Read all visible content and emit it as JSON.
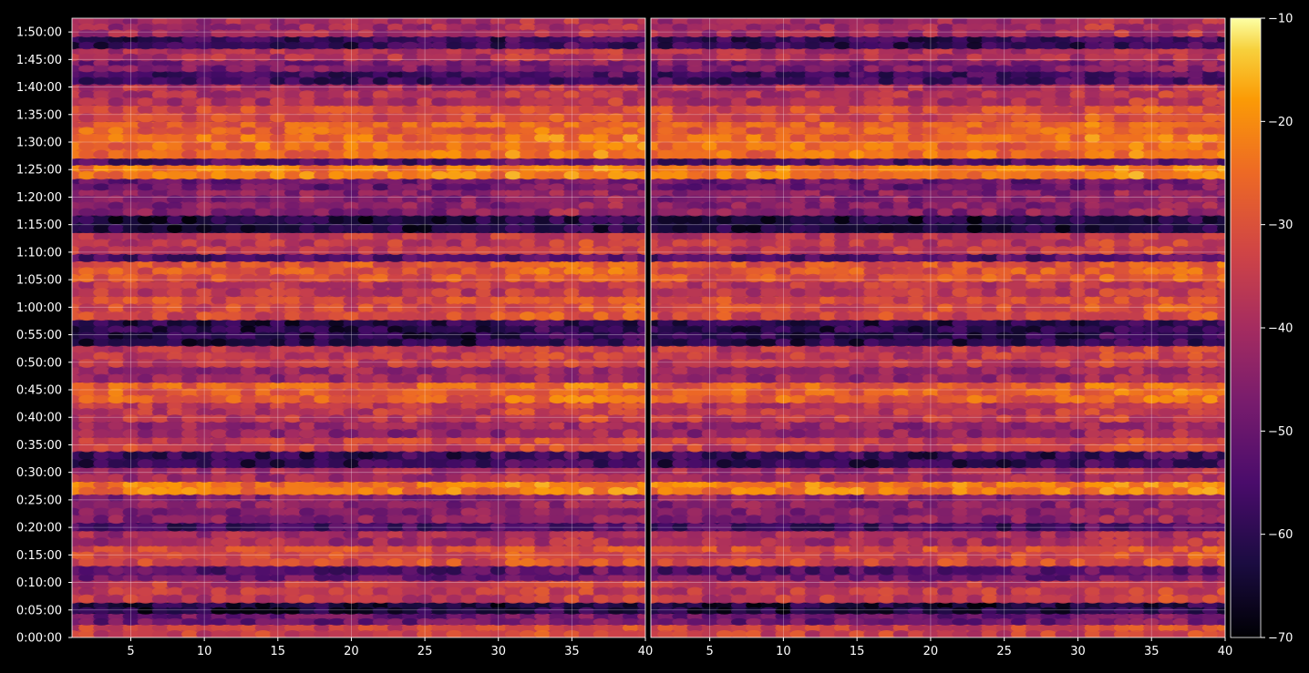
{
  "chart_data": {
    "type": "heatmap",
    "title": "",
    "xlabel": "",
    "ylabel": "",
    "panels": 2,
    "x_ticks": [
      "5",
      "10",
      "15",
      "20",
      "25",
      "30",
      "35",
      "40"
    ],
    "x_tick_values": [
      5,
      10,
      15,
      20,
      25,
      30,
      35,
      40
    ],
    "xlim": [
      1,
      40
    ],
    "y_ticks": [
      "0:00:00",
      "0:05:00",
      "0:10:00",
      "0:15:00",
      "0:20:00",
      "0:25:00",
      "0:30:00",
      "0:35:00",
      "0:40:00",
      "0:45:00",
      "0:50:00",
      "0:55:00",
      "1:00:00",
      "1:05:00",
      "1:10:00",
      "1:15:00",
      "1:20:00",
      "1:25:00",
      "1:30:00",
      "1:35:00",
      "1:40:00",
      "1:45:00",
      "1:50:00"
    ],
    "y_tick_seconds": [
      0,
      300,
      600,
      900,
      1200,
      1500,
      1800,
      2100,
      2400,
      2700,
      3000,
      3300,
      3600,
      3900,
      4200,
      4500,
      4800,
      5100,
      5400,
      5700,
      6000,
      6300,
      6600
    ],
    "ylim_seconds": [
      0,
      6750
    ],
    "colorbar": {
      "ticks": [
        "−10",
        "−20",
        "−30",
        "−40",
        "−50",
        "−60",
        "−70"
      ],
      "tick_values": [
        -10,
        -20,
        -30,
        -40,
        -50,
        -60,
        -70
      ],
      "range": [
        -70,
        -10
      ],
      "colormap": "inferno"
    },
    "grid": true,
    "band_levels": [
      {
        "t0": 0,
        "t1": 140,
        "level": -38
      },
      {
        "t0": 140,
        "t1": 260,
        "level": -52
      },
      {
        "t0": 260,
        "t1": 380,
        "level": -64
      },
      {
        "t0": 380,
        "t1": 620,
        "level": -40
      },
      {
        "t0": 620,
        "t1": 680,
        "level": -52
      },
      {
        "t0": 680,
        "t1": 780,
        "level": -55
      },
      {
        "t0": 780,
        "t1": 1000,
        "level": -36
      },
      {
        "t0": 1000,
        "t1": 1160,
        "level": -44
      },
      {
        "t0": 1160,
        "t1": 1250,
        "level": -58
      },
      {
        "t0": 1250,
        "t1": 1560,
        "level": -48
      },
      {
        "t0": 1560,
        "t1": 1700,
        "level": -28
      },
      {
        "t0": 1700,
        "t1": 1850,
        "level": -44
      },
      {
        "t0": 1850,
        "t1": 2030,
        "level": -60
      },
      {
        "t0": 2030,
        "t1": 2180,
        "level": -38
      },
      {
        "t0": 2180,
        "t1": 2350,
        "level": -46
      },
      {
        "t0": 2350,
        "t1": 2560,
        "level": -40
      },
      {
        "t0": 2560,
        "t1": 2780,
        "level": -32
      },
      {
        "t0": 2780,
        "t1": 2950,
        "level": -46
      },
      {
        "t0": 2950,
        "t1": 3180,
        "level": -40
      },
      {
        "t0": 3180,
        "t1": 3460,
        "level": -62
      },
      {
        "t0": 3460,
        "t1": 3720,
        "level": -36
      },
      {
        "t0": 3720,
        "t1": 3880,
        "level": -40
      },
      {
        "t0": 3880,
        "t1": 4100,
        "level": -34
      },
      {
        "t0": 4100,
        "t1": 4180,
        "level": -56
      },
      {
        "t0": 4180,
        "t1": 4410,
        "level": -40
      },
      {
        "t0": 4410,
        "t1": 4600,
        "level": -64
      },
      {
        "t0": 4600,
        "t1": 4880,
        "level": -48
      },
      {
        "t0": 4880,
        "t1": 5000,
        "level": -52
      },
      {
        "t0": 5000,
        "t1": 5150,
        "level": -28
      },
      {
        "t0": 5150,
        "t1": 5220,
        "level": -56
      },
      {
        "t0": 5220,
        "t1": 5490,
        "level": -30
      },
      {
        "t0": 5490,
        "t1": 5620,
        "level": -32
      },
      {
        "t0": 5620,
        "t1": 5800,
        "level": -36
      },
      {
        "t0": 5800,
        "t1": 6030,
        "level": -42
      },
      {
        "t0": 6030,
        "t1": 6170,
        "level": -58
      },
      {
        "t0": 6170,
        "t1": 6290,
        "level": -50
      },
      {
        "t0": 6290,
        "t1": 6420,
        "level": -42
      },
      {
        "t0": 6420,
        "t1": 6550,
        "level": -60
      },
      {
        "t0": 6550,
        "t1": 6750,
        "level": -44
      }
    ]
  }
}
